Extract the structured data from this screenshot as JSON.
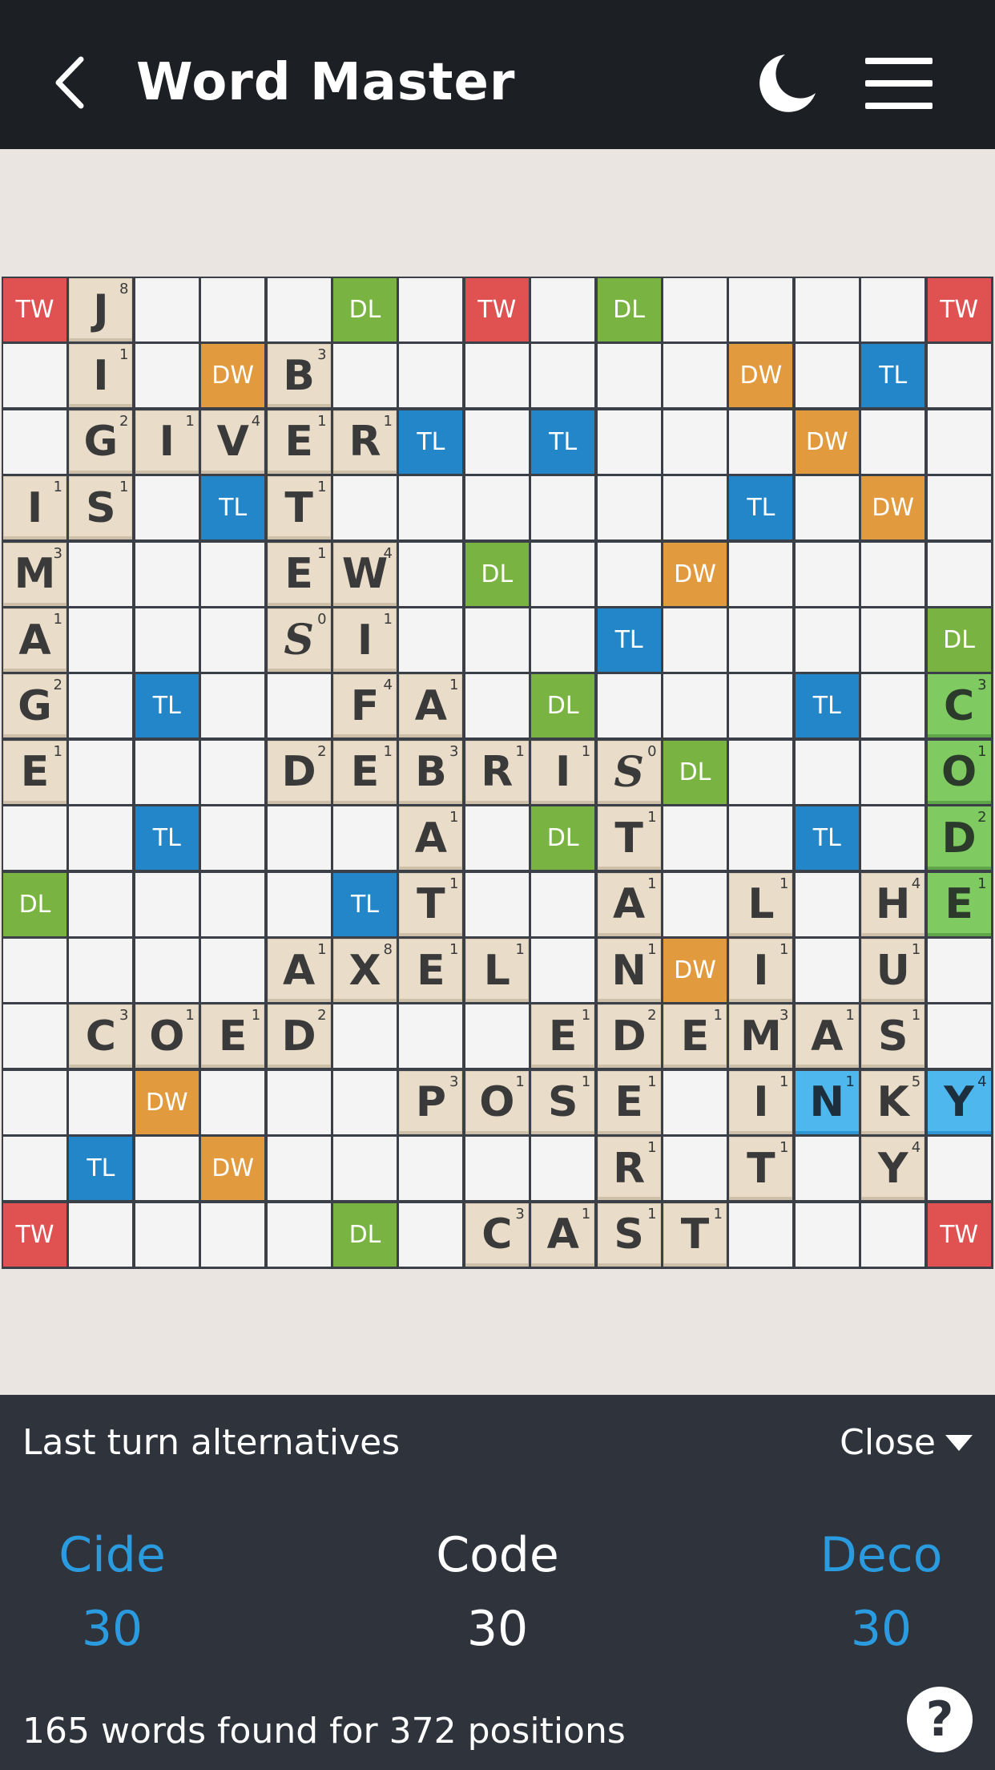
{
  "app": {
    "title": "Word Master"
  },
  "header": {
    "back_icon": "chevron-left-icon",
    "moon_icon": "moon-icon",
    "menu_icon": "hamburger-menu-icon"
  },
  "colors": {
    "TW": "#e05252",
    "DW": "#e29a3e",
    "TL": "#2386c8",
    "DL": "#79b342",
    "tile": "#e9dcc8",
    "highlight_green": "#7fcb62",
    "highlight_blue": "#4db7ee",
    "accent_blue": "#2b9be0"
  },
  "board": {
    "size": 15,
    "premiums": [
      [
        0,
        0,
        "TW"
      ],
      [
        0,
        5,
        "DL"
      ],
      [
        0,
        7,
        "TW"
      ],
      [
        0,
        9,
        "DL"
      ],
      [
        0,
        14,
        "TW"
      ],
      [
        1,
        3,
        "DW"
      ],
      [
        1,
        11,
        "DW"
      ],
      [
        1,
        13,
        "TL"
      ],
      [
        2,
        6,
        "TL"
      ],
      [
        2,
        8,
        "TL"
      ],
      [
        2,
        12,
        "DW"
      ],
      [
        3,
        3,
        "TL"
      ],
      [
        3,
        11,
        "TL"
      ],
      [
        3,
        13,
        "DW"
      ],
      [
        4,
        7,
        "DL"
      ],
      [
        4,
        10,
        "DW"
      ],
      [
        5,
        9,
        "TL"
      ],
      [
        5,
        14,
        "DL"
      ],
      [
        6,
        2,
        "TL"
      ],
      [
        6,
        8,
        "DL"
      ],
      [
        6,
        12,
        "TL"
      ],
      [
        7,
        10,
        "DL"
      ],
      [
        8,
        2,
        "TL"
      ],
      [
        8,
        8,
        "DL"
      ],
      [
        8,
        12,
        "TL"
      ],
      [
        9,
        0,
        "DL"
      ],
      [
        9,
        5,
        "TL"
      ],
      [
        10,
        10,
        "DW"
      ],
      [
        12,
        2,
        "DW"
      ],
      [
        13,
        1,
        "TL"
      ],
      [
        13,
        3,
        "DW"
      ],
      [
        14,
        0,
        "TW"
      ],
      [
        14,
        5,
        "DL"
      ],
      [
        14,
        14,
        "TW"
      ]
    ],
    "tiles": [
      [
        0,
        1,
        "J",
        "8",
        ""
      ],
      [
        1,
        1,
        "I",
        "1",
        ""
      ],
      [
        1,
        4,
        "B",
        "3",
        ""
      ],
      [
        2,
        1,
        "G",
        "2",
        ""
      ],
      [
        2,
        2,
        "I",
        "1",
        ""
      ],
      [
        2,
        3,
        "V",
        "4",
        ""
      ],
      [
        2,
        4,
        "E",
        "1",
        ""
      ],
      [
        2,
        5,
        "R",
        "1",
        ""
      ],
      [
        3,
        0,
        "I",
        "1",
        ""
      ],
      [
        3,
        1,
        "S",
        "1",
        ""
      ],
      [
        3,
        4,
        "T",
        "1",
        ""
      ],
      [
        4,
        0,
        "M",
        "3",
        ""
      ],
      [
        4,
        4,
        "E",
        "1",
        ""
      ],
      [
        4,
        5,
        "W",
        "4",
        ""
      ],
      [
        5,
        0,
        "A",
        "1",
        ""
      ],
      [
        5,
        4,
        "S",
        "0",
        "blank"
      ],
      [
        5,
        5,
        "I",
        "1",
        ""
      ],
      [
        6,
        0,
        "G",
        "2",
        ""
      ],
      [
        6,
        5,
        "F",
        "4",
        ""
      ],
      [
        6,
        6,
        "A",
        "1",
        ""
      ],
      [
        7,
        0,
        "E",
        "1",
        ""
      ],
      [
        7,
        4,
        "D",
        "2",
        ""
      ],
      [
        7,
        5,
        "E",
        "1",
        ""
      ],
      [
        7,
        6,
        "B",
        "3",
        ""
      ],
      [
        7,
        7,
        "R",
        "1",
        ""
      ],
      [
        7,
        8,
        "I",
        "1",
        ""
      ],
      [
        7,
        9,
        "S",
        "0",
        "blank"
      ],
      [
        8,
        6,
        "A",
        "1",
        ""
      ],
      [
        8,
        9,
        "T",
        "1",
        ""
      ],
      [
        9,
        6,
        "T",
        "1",
        ""
      ],
      [
        9,
        9,
        "A",
        "1",
        ""
      ],
      [
        9,
        11,
        "L",
        "1",
        ""
      ],
      [
        9,
        13,
        "H",
        "4",
        ""
      ],
      [
        10,
        4,
        "A",
        "1",
        ""
      ],
      [
        10,
        5,
        "X",
        "8",
        ""
      ],
      [
        10,
        6,
        "E",
        "1",
        ""
      ],
      [
        10,
        7,
        "L",
        "1",
        ""
      ],
      [
        10,
        9,
        "N",
        "1",
        ""
      ],
      [
        10,
        11,
        "I",
        "1",
        ""
      ],
      [
        10,
        13,
        "U",
        "1",
        ""
      ],
      [
        11,
        1,
        "C",
        "3",
        ""
      ],
      [
        11,
        2,
        "O",
        "1",
        ""
      ],
      [
        11,
        3,
        "E",
        "1",
        ""
      ],
      [
        11,
        4,
        "D",
        "2",
        ""
      ],
      [
        11,
        8,
        "E",
        "1",
        ""
      ],
      [
        11,
        9,
        "D",
        "2",
        ""
      ],
      [
        11,
        10,
        "E",
        "1",
        ""
      ],
      [
        11,
        11,
        "M",
        "3",
        ""
      ],
      [
        11,
        12,
        "A",
        "1",
        ""
      ],
      [
        11,
        13,
        "S",
        "1",
        ""
      ],
      [
        12,
        6,
        "P",
        "3",
        ""
      ],
      [
        12,
        7,
        "O",
        "1",
        ""
      ],
      [
        12,
        8,
        "S",
        "1",
        ""
      ],
      [
        12,
        9,
        "E",
        "1",
        ""
      ],
      [
        12,
        11,
        "I",
        "1",
        ""
      ],
      [
        12,
        12,
        "N",
        "1",
        "blue"
      ],
      [
        12,
        13,
        "K",
        "5",
        ""
      ],
      [
        12,
        14,
        "Y",
        "4",
        "blue"
      ],
      [
        13,
        9,
        "R",
        "1",
        ""
      ],
      [
        13,
        11,
        "T",
        "1",
        ""
      ],
      [
        13,
        13,
        "Y",
        "4",
        ""
      ],
      [
        14,
        7,
        "C",
        "3",
        ""
      ],
      [
        14,
        8,
        "A",
        "1",
        ""
      ],
      [
        14,
        9,
        "S",
        "1",
        ""
      ],
      [
        14,
        10,
        "T",
        "1",
        ""
      ],
      [
        6,
        14,
        "C",
        "3",
        "green"
      ],
      [
        7,
        14,
        "O",
        "1",
        "green"
      ],
      [
        8,
        14,
        "D",
        "2",
        "green"
      ],
      [
        9,
        14,
        "E",
        "1",
        "green"
      ]
    ]
  },
  "panel": {
    "title": "Last turn alternatives",
    "close_label": "Close",
    "alternatives": [
      {
        "word": "Cide",
        "score": "30"
      },
      {
        "word": "Code",
        "score": "30"
      },
      {
        "word": "Deco",
        "score": "30"
      }
    ],
    "footer": "165 words found for 372 positions",
    "help_label": "?"
  }
}
